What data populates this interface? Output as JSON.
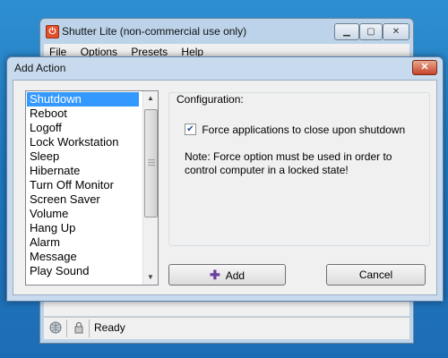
{
  "parent_window": {
    "title": "Shutter Lite (non-commercial use only)",
    "icon": "shutter-app-icon",
    "menu": [
      "File",
      "Options",
      "Presets",
      "Help"
    ],
    "status": "Ready"
  },
  "dialog": {
    "title": "Add Action",
    "actions": [
      "Shutdown",
      "Reboot",
      "Logoff",
      "Lock Workstation",
      "Sleep",
      "Hibernate",
      "Turn Off Monitor",
      "Screen Saver",
      "Volume",
      "Hang Up",
      "Alarm",
      "Message",
      "Play Sound"
    ],
    "selected_index": 0,
    "configuration": {
      "label": "Configuration:",
      "checkbox_label": "Force applications to close upon shutdown",
      "checkbox_checked": true,
      "note": "Note: Force option must be used in order to control computer in a locked state!"
    },
    "buttons": {
      "add": "Add",
      "cancel": "Cancel"
    }
  },
  "colors": {
    "selection": "#3399ff",
    "desktop": "#1f79c0",
    "dialog_frame": "#c8daee"
  }
}
